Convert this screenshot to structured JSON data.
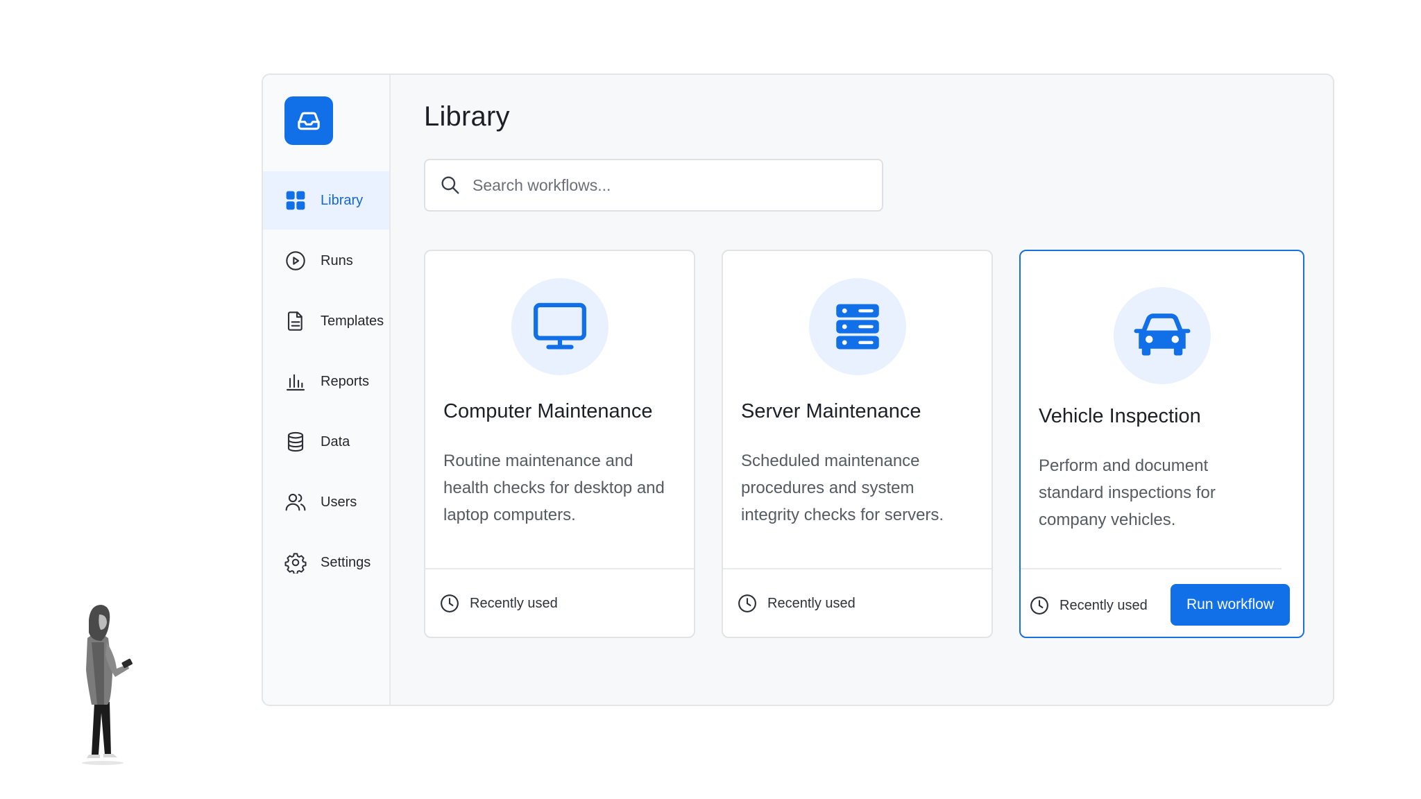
{
  "sidebar": {
    "logo_icon": "inbox-tray-icon",
    "items": [
      {
        "label": "Library",
        "icon": "grid-icon",
        "active": true
      },
      {
        "label": "Runs",
        "icon": "play-circle-icon",
        "active": false
      },
      {
        "label": "Templates",
        "icon": "document-icon",
        "active": false
      },
      {
        "label": "Reports",
        "icon": "bar-chart-icon",
        "active": false
      },
      {
        "label": "Data",
        "icon": "database-icon",
        "active": false
      },
      {
        "label": "Users",
        "icon": "users-icon",
        "active": false
      },
      {
        "label": "Settings",
        "icon": "gear-icon",
        "active": false
      }
    ]
  },
  "main": {
    "title": "Library",
    "search": {
      "placeholder": "Search workflows...",
      "value": ""
    },
    "cards": [
      {
        "title": "Computer Maintenance",
        "description": "Routine maintenance and health checks for desktop and laptop computers.",
        "icon": "monitor-icon",
        "footer": "Recently used"
      },
      {
        "title": "Server Maintenance",
        "description": "Scheduled maintenance procedures and system integrity checks for servers.",
        "icon": "server-icon",
        "footer": "Recently used"
      },
      {
        "title": "Vehicle Inspection",
        "description": "Perform and document standard inspections for company vehicles.",
        "icon": "car-icon",
        "footer": "Recently used",
        "action_label": "Run workflow",
        "selected": true
      }
    ]
  },
  "colors": {
    "accent": "#1170e8",
    "active_nav_bg": "#e9f2fe",
    "icon_circle_bg": "#e8f1fd",
    "selected_border": "#1a6fe0"
  }
}
